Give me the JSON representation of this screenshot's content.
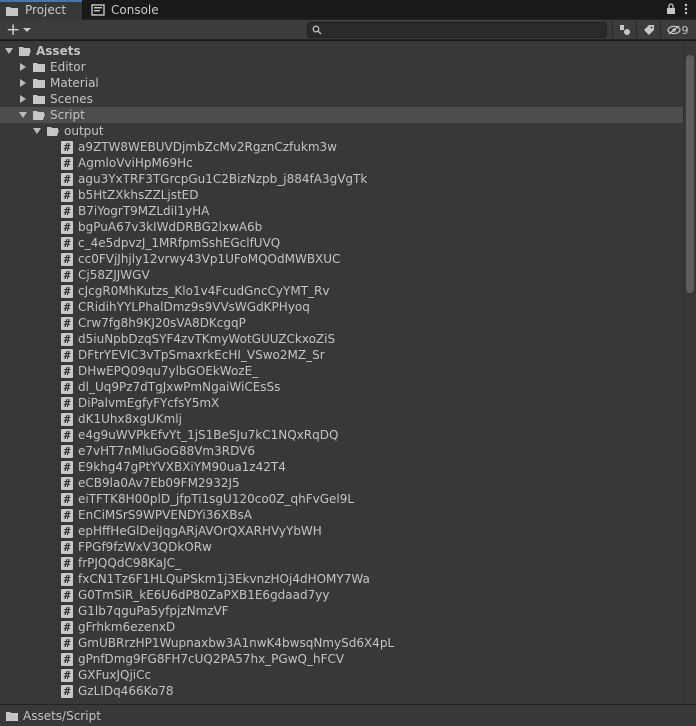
{
  "tabs": [
    {
      "label": "Project",
      "icon": "folder-icon",
      "active": true
    },
    {
      "label": "Console",
      "icon": "console-icon",
      "active": false
    }
  ],
  "toolbar": {
    "add_label": "+",
    "search_placeholder": "",
    "hidden_count": "9"
  },
  "tree": {
    "assets": "Assets",
    "folders": [
      "Editor",
      "Material",
      "Scenes"
    ],
    "script": "Script",
    "output": "output",
    "files": [
      "a9ZTW8WEBUVDjmbZcMv2RgznCzfukm3w",
      "AgmloVviHpM69Hc",
      "agu3YxTRF3TGrcpGu1C2BizNzpb_j884fA3gVgTk",
      "b5HtZXkhsZZLjstED",
      "B7iYogrT9MZLdil1yHA",
      "bgPuA67v3kIWdDRBG2lxwA6b",
      "c_4e5dpvzJ_1MRfpmSshEGclfUVQ",
      "cc0FVjJhjly12vrwy43Vp1UFoMQOdMWBXUC",
      "Cj58ZJJWGV",
      "cJcgR0MhKutzs_Klo1v4FcudGncCyYMT_Rv",
      "CRidihYYLPhalDmz9s9VVsWGdKPHyoq",
      "Crw7fg8h9KJ20sVA8DKcgqP",
      "d5iuNpbDzqSYF4zvTKmyWotGUUZCkxoZiS",
      "DFtrYEVIC3vTpSmaxrkEcHI_VSwo2MZ_Sr",
      "DHwEPQ09qu7ylbGOEkWozE_",
      "dl_Uq9Pz7dTgJxwPmNgaiWiCEsSs",
      "DiPalvmEgfyFYcfsY5mX",
      "dK1Uhx8xgUKmlj",
      "e4g9uWVPkEfvYt_1jS1BeSJu7kC1NQxRqDQ",
      "e7vHT7nMluGoG88Vm3RDV6",
      "E9khg47gPtYVXBXiYM90ua1z42T4",
      "eCB9la0Av7Eb09FM2932J5",
      "eiTFTK8H00plD_jfpTi1sgU120co0Z_qhFvGel9L",
      "EnCiMSrS9WPVENDYi36XBsA",
      "epHffHeGlDeiJqgARjAVOrQXARHVyYbWH",
      "FPGf9fzWxV3QDkORw",
      "frPJQQdC98KaJC_",
      "fxCN1Tz6F1HLQuPSkm1j3EkvnzHOj4dHOMY7Wa",
      "G0TmSiR_kE6U6dP80ZaPXB1E6gdaad7yy",
      "G1lb7qguPa5yfpjzNmzVF",
      "gFrhkm6ezenxD",
      "GmUBRrzHP1Wupnaxbw3A1nwK4bwsqNmySd6X4pL",
      "gPnfDmg9FG8FH7cUQ2PA57hx_PGwQ_hFCV",
      "GXFuxJQjiCc",
      "GzLIDq466Ko78"
    ]
  },
  "status": {
    "path": "Assets/Script"
  },
  "colors": {
    "panel_bg": "#383838",
    "tab_accent": "#3a79bb",
    "selection": "#4d4d4d"
  }
}
